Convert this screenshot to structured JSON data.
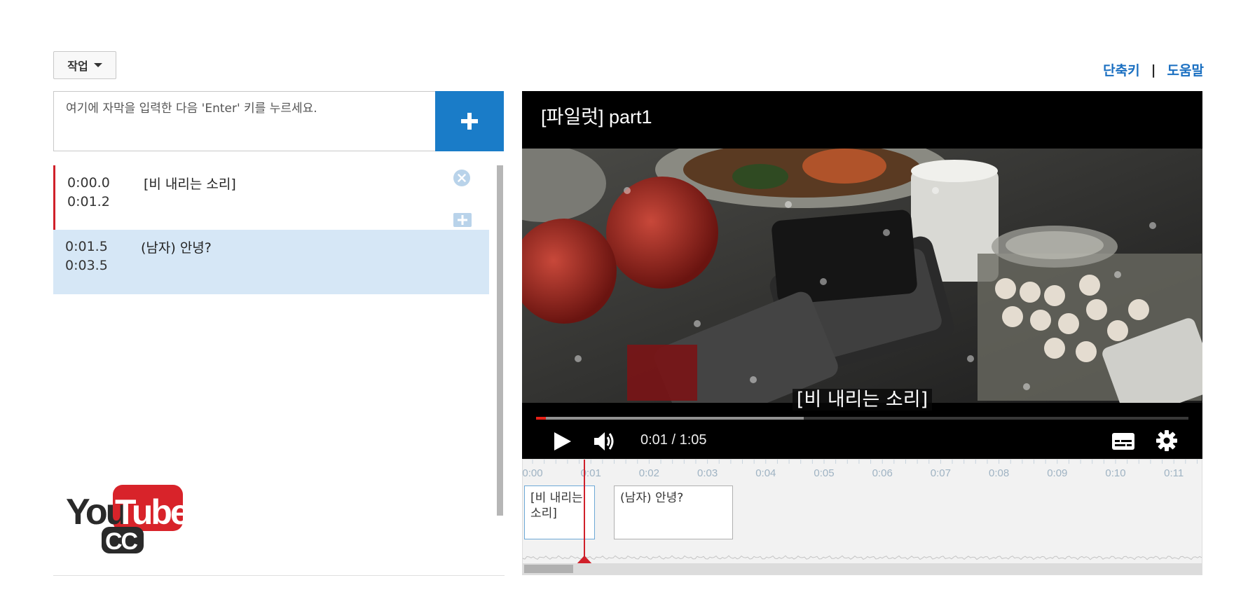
{
  "toolbar": {
    "actions_label": "작업"
  },
  "links": {
    "shortcuts": "단축키",
    "separator": "|",
    "help": "도움말"
  },
  "input": {
    "placeholder": "여기에 자막을 입력한 다음 'Enter' 키를 누르세요.",
    "value": ""
  },
  "captions": [
    {
      "start": "0:00.0",
      "end": "0:01.2",
      "text": "[비 내리는 소리]"
    },
    {
      "start": "0:01.5",
      "end": "0:03.5",
      "text": "(남자) 안녕?"
    }
  ],
  "player": {
    "title": "[파일럿] part1",
    "subtitle": "[비 내리는 소리]",
    "current_time": "0:01",
    "duration": "1:05",
    "time_separator": "/",
    "played_fraction": 0.015,
    "loaded_fraction": 0.41
  },
  "timeline": {
    "ticks": [
      "0:00",
      "0:01",
      "0:02",
      "0:03",
      "0:04",
      "0:05",
      "0:06",
      "0:07",
      "0:08",
      "0:09",
      "0:10",
      "0:11"
    ],
    "blocks": [
      {
        "text": "[비 내리는 소리]"
      },
      {
        "text": "(남자) 안녕?"
      }
    ]
  },
  "logo": {
    "brand_top": "You",
    "brand_tube": "Tube",
    "brand_cc": "CC"
  },
  "colors": {
    "accent_blue": "#1a7cc8",
    "link_blue": "#1a6fc1",
    "selected_row": "#d6e7f6",
    "active_red": "#d0202a",
    "youtube_red": "#e62117"
  },
  "icons": [
    "caret-down-icon",
    "plus-icon",
    "close-icon",
    "play-icon",
    "volume-icon",
    "captions-icon",
    "gear-icon"
  ]
}
